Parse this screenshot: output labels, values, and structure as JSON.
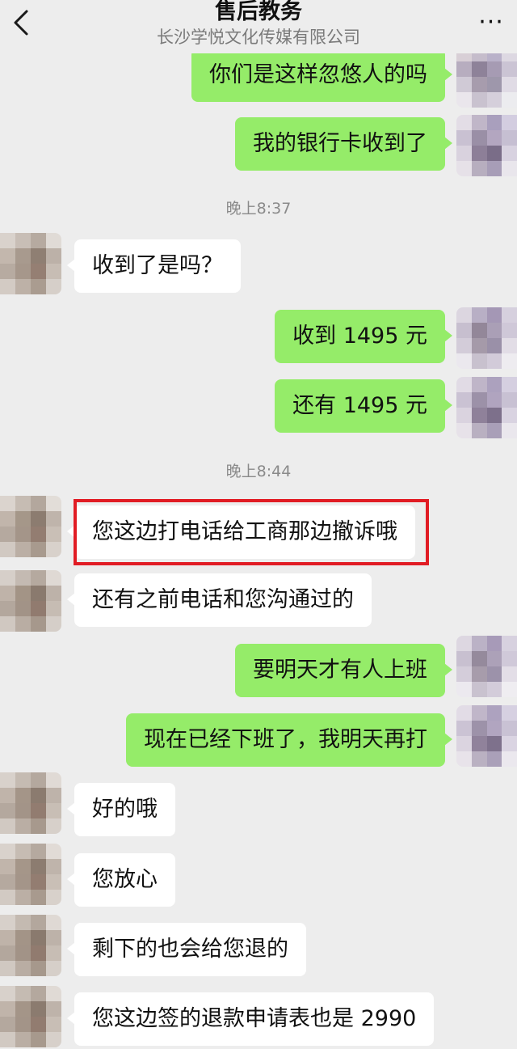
{
  "header": {
    "title": "售后教务",
    "subtitle": "长沙学悦文化传媒有限公司",
    "back_icon": "chevron-left-icon",
    "more_label": "···"
  },
  "colors": {
    "background": "#ededed",
    "outgoing_bubble": "#95ec69",
    "incoming_bubble": "#ffffff",
    "highlight_border": "#e11c24",
    "timestamp_text": "#8a8a8a"
  },
  "messages": [
    {
      "text": "你们是这样忽悠人的吗",
      "direction": "out"
    },
    {
      "text": "我的银行卡收到了",
      "direction": "out"
    },
    {
      "time": "晚上8:37"
    },
    {
      "text": "收到了是吗？",
      "direction": "in"
    },
    {
      "text": "收到 1495 元",
      "direction": "out"
    },
    {
      "text": "还有 1495 元",
      "direction": "out"
    },
    {
      "time": "晚上8:44"
    },
    {
      "text": "您这边打电话给工商那边撤诉哦",
      "direction": "in",
      "highlighted": true
    },
    {
      "text": "还有之前电话和您沟通过的",
      "direction": "in"
    },
    {
      "text": "要明天才有人上班",
      "direction": "out"
    },
    {
      "text": "现在已经下班了，我明天再打",
      "direction": "out"
    },
    {
      "text": "好的哦",
      "direction": "in"
    },
    {
      "text": "您放心",
      "direction": "in"
    },
    {
      "text": "剩下的也会给您退的",
      "direction": "in"
    },
    {
      "text": "您这边签的退款申请表也是 2990",
      "direction": "in"
    }
  ]
}
